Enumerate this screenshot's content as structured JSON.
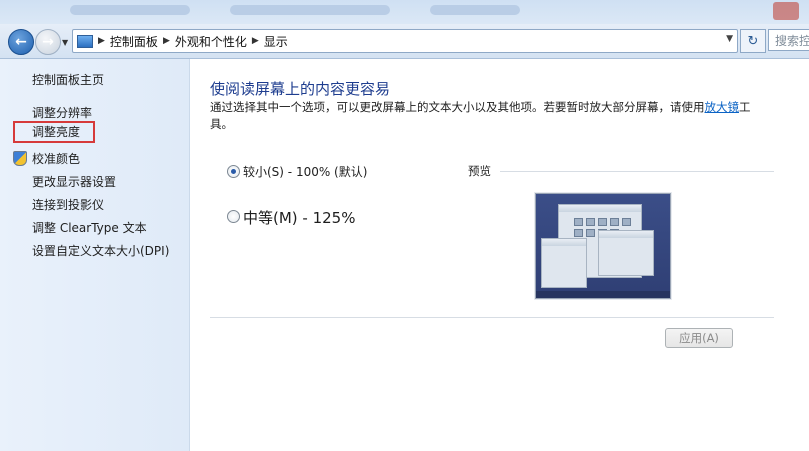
{
  "address_bar": {
    "crumbs": [
      "控制面板",
      "外观和个性化",
      "显示"
    ],
    "search_placeholder": "搜索控制"
  },
  "sidebar": {
    "home": "控制面板主页",
    "items": [
      {
        "label": "调整分辨率"
      },
      {
        "label": "调整亮度",
        "highlighted": true
      },
      {
        "label": "校准颜色",
        "icon": "shield-icon"
      },
      {
        "label": "更改显示器设置"
      },
      {
        "label": "连接到投影仪"
      },
      {
        "label": "调整 ClearType 文本"
      },
      {
        "label": "设置自定义文本大小(DPI)"
      }
    ]
  },
  "main": {
    "title": "使阅读屏幕上的内容更容易",
    "description_part1": "通过选择其中一个选项，可以更改屏幕上的文本大小以及其他项。若要暂时放大部分屏幕，请使用",
    "description_link": "放大镜",
    "description_part2": "工具。",
    "options": [
      {
        "label": "较小(S) - 100% (默认)",
        "selected": true
      },
      {
        "label": "中等(M) - 125%",
        "selected": false
      }
    ],
    "preview_label": "预览",
    "apply_label": "应用(A)"
  },
  "colors": {
    "title": "#1e3d8f",
    "link": "#0b63c5",
    "highlight_box": "#d63a3a",
    "sidebar_bg": "#e4eefa"
  }
}
